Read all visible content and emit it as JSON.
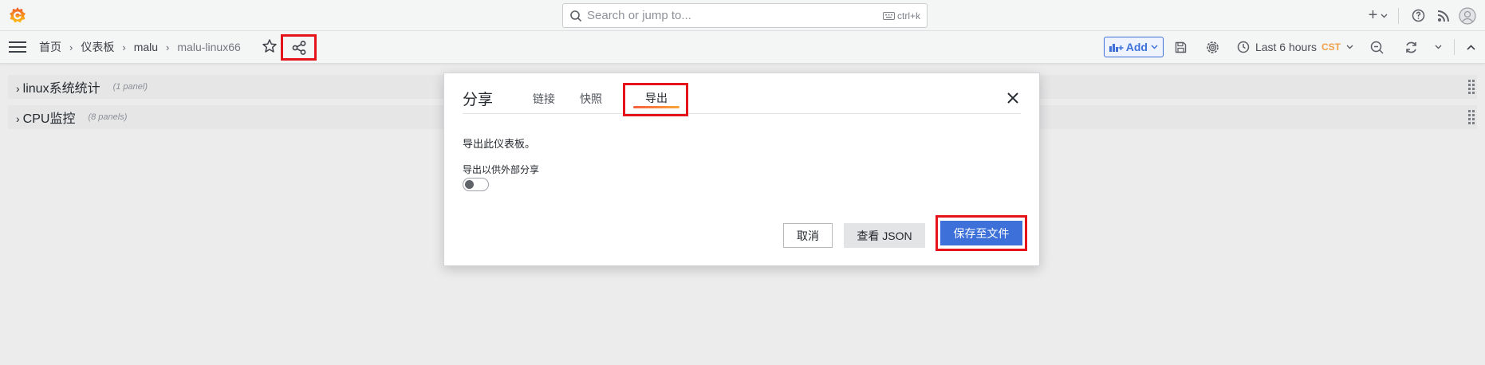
{
  "topbar": {
    "search": {
      "placeholder": "Search or jump to...",
      "shortcut": "ctrl+k"
    },
    "plus_label": "+"
  },
  "navbar": {
    "breadcrumbs": [
      "首页",
      "仪表板",
      "malu",
      "malu-linux66"
    ],
    "add_label": "Add",
    "time_range": "Last 6 hours",
    "timezone": "CST"
  },
  "rows": [
    {
      "title": "linux系统统计",
      "count": "(1 panel)"
    },
    {
      "title": "CPU监控",
      "count": "(8 panels)"
    }
  ],
  "modal": {
    "title": "分享",
    "tabs": [
      "链接",
      "快照",
      "导出"
    ],
    "active_tab": "导出",
    "description": "导出此仪表板。",
    "toggle_label": "导出以供外部分享",
    "toggle_on": false,
    "buttons": {
      "cancel": "取消",
      "view_json": "查看 JSON",
      "save": "保存至文件"
    }
  },
  "colors": {
    "highlight": "#e5131a",
    "primary": "#3d71d9",
    "tab_underline_start": "#f55f3e",
    "tab_underline_end": "#fba63b",
    "timezone": "#f0a04b"
  }
}
